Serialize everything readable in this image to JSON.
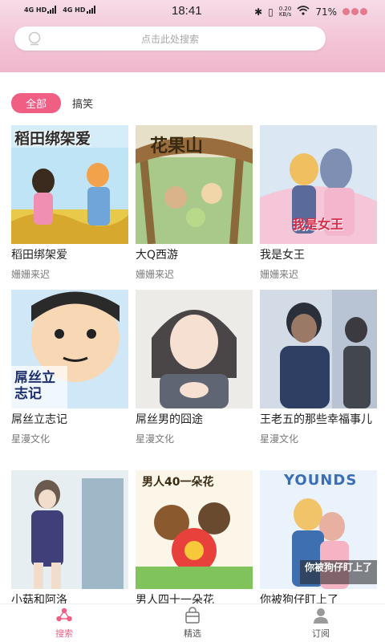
{
  "status_bar": {
    "net1": "4G HD",
    "net2": "4G HD",
    "time": "18:41",
    "speed_value": "0.20",
    "speed_unit": "KB/s",
    "battery": "71%"
  },
  "search": {
    "placeholder": "点击此处搜索"
  },
  "filter_tabs": {
    "active": "全部",
    "other": "搞笑"
  },
  "comics": [
    {
      "title": "稻田绑架爱",
      "author": "姗姗来迟"
    },
    {
      "title": "大Q西游",
      "author": "姗姗来迟"
    },
    {
      "title": "我是女王",
      "author": "姗姗来迟"
    },
    {
      "title": "屌丝立志记",
      "author": "星漫文化"
    },
    {
      "title": "屌丝男的囧途",
      "author": "星漫文化"
    },
    {
      "title": "王老五的那些幸福事儿",
      "author": "星漫文化"
    },
    {
      "title": "小菇和阿洛",
      "author": ""
    },
    {
      "title": "男人四十一朵花",
      "author": ""
    },
    {
      "title": "你被狗仔盯上了",
      "author": ""
    }
  ],
  "covers": {
    "c1": "稻田绑架爱",
    "c2": "花果山",
    "c3": "我是女王",
    "c4": "屌丝立志记",
    "c8": "男人40一朵花",
    "c9_top": "YOUNDS",
    "c9_text": "你被狗仔盯上了"
  },
  "tab_bar": {
    "items": [
      {
        "label": "搜索",
        "icon": "search-tab-icon"
      },
      {
        "label": "精选",
        "icon": "bag-icon"
      },
      {
        "label": "订阅",
        "icon": "user-icon"
      }
    ]
  },
  "colors": {
    "accent": "#f05e84",
    "header_pink": "#f3c3d6"
  }
}
